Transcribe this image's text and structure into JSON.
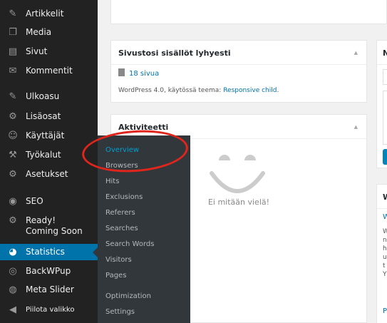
{
  "sidebar": {
    "items": [
      {
        "label": "Artikkelit",
        "icon": "pin-icon",
        "glyph": "✎"
      },
      {
        "label": "Media",
        "icon": "media-icon",
        "glyph": "❐"
      },
      {
        "label": "Sivut",
        "icon": "pages-icon",
        "glyph": "▤"
      },
      {
        "label": "Kommentit",
        "icon": "comments-icon",
        "glyph": "✉"
      },
      {
        "label": "Ulkoasu",
        "icon": "appearance-icon",
        "glyph": "✎"
      },
      {
        "label": "Lisäosat",
        "icon": "plugins-icon",
        "glyph": "⚙"
      },
      {
        "label": "Käyttäjät",
        "icon": "users-icon",
        "glyph": "☺"
      },
      {
        "label": "Työkalut",
        "icon": "tools-icon",
        "glyph": "⚒"
      },
      {
        "label": "Asetukset",
        "icon": "settings-icon",
        "glyph": "⚙"
      },
      {
        "label": "SEO",
        "icon": "seo-icon",
        "glyph": "◉"
      },
      {
        "label": "Ready! Coming Soon",
        "icon": "gear-icon",
        "glyph": "⚙"
      },
      {
        "label": "Statistics",
        "icon": "pie-chart-icon",
        "glyph": "◕"
      },
      {
        "label": "BackWPup",
        "icon": "backwpup-icon",
        "glyph": "◎"
      },
      {
        "label": "Meta Slider",
        "icon": "meta-slider-icon",
        "glyph": "◍"
      },
      {
        "label": "Piilota valikko",
        "icon": "collapse-icon",
        "glyph": "◀"
      }
    ],
    "active_index": 11
  },
  "flyout": {
    "items": [
      "Overview",
      "Browsers",
      "Hits",
      "Exclusions",
      "Referers",
      "Searches",
      "Search Words",
      "Visitors",
      "Pages",
      "Optimization",
      "Settings"
    ]
  },
  "glance_box": {
    "title": "Sivustosi sisällöt lyhyesti",
    "pages_link": "18 sivua",
    "version_text": "WordPress 4.0, käytössä teema: ",
    "theme_link": "Responsive child",
    "version_suffix": "."
  },
  "activity_box": {
    "title": "Aktiviteetti",
    "empty_text": "Ei mitään vielä!"
  },
  "right_top_box": {
    "title_char": "N"
  },
  "right_bottom_box": {
    "title_char": "W",
    "link_char": "W",
    "text_chars": [
      "W",
      "n",
      "h",
      "u",
      "t",
      "Y"
    ],
    "footer_char": "P"
  },
  "colors": {
    "sidebar_bg": "#222222",
    "flyout_bg": "#32373c",
    "active_bg": "#0073aa",
    "link": "#0073aa",
    "highlight_circle": "#e0261c"
  }
}
